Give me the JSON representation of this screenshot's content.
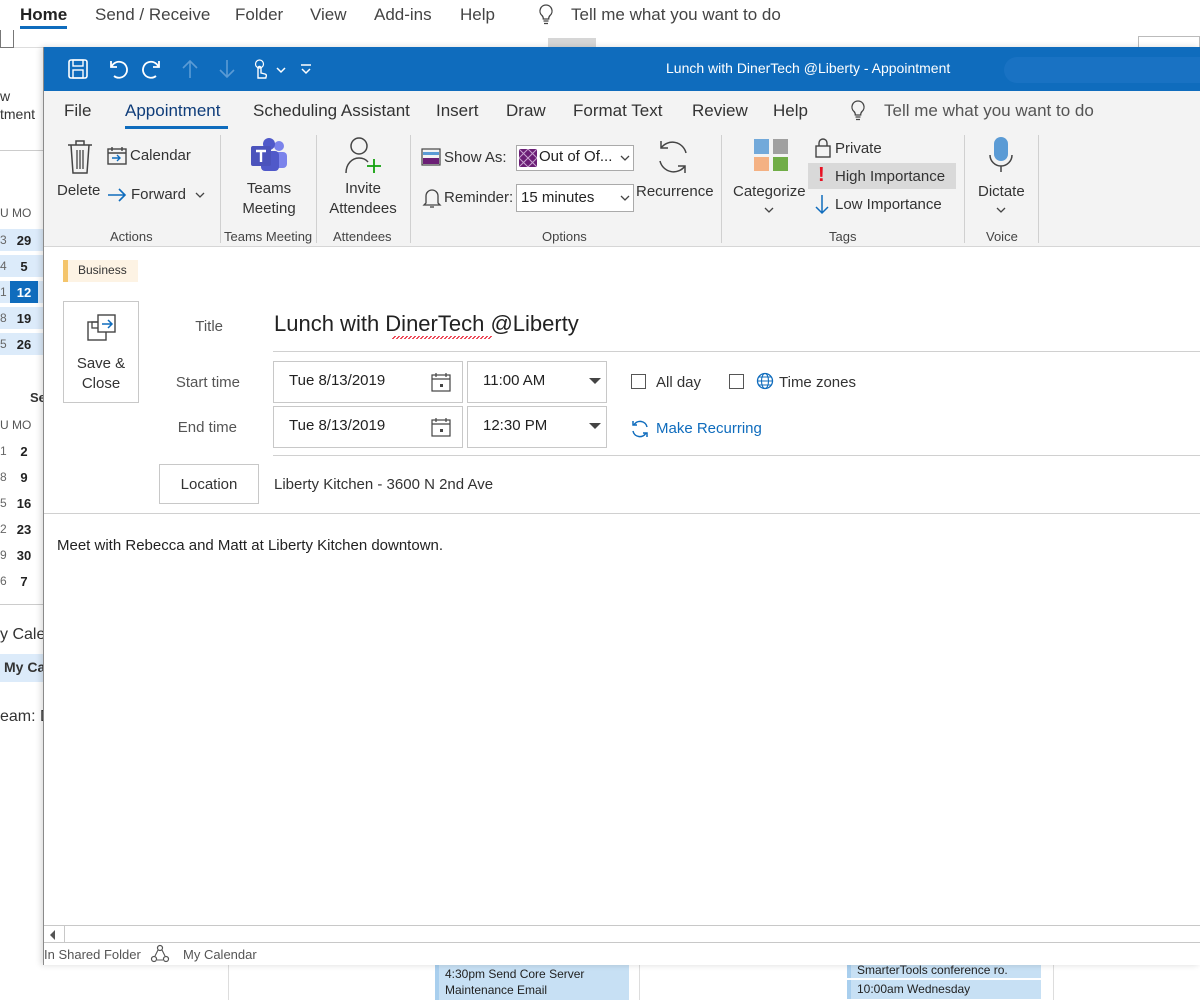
{
  "bg_menu": {
    "tabs": [
      "Home",
      "Send / Receive",
      "Folder",
      "View",
      "Add-ins",
      "Help"
    ],
    "tell_me": "Tell me what you want to do"
  },
  "bg_left": {
    "partial_w": "w",
    "partial_tment": "tment",
    "day_header_1": "MO",
    "day_header_2": "MO",
    "month_1_rows": [
      {
        "prev": "3",
        "date": "29"
      },
      {
        "prev": "4",
        "date": "5"
      },
      {
        "prev": "1",
        "date": "12"
      },
      {
        "prev": "8",
        "date": "19"
      },
      {
        "prev": "5",
        "date": "26"
      }
    ],
    "month_2_label": "Se",
    "month_2_rows": [
      {
        "prev": "1",
        "date": "2"
      },
      {
        "prev": "8",
        "date": "9"
      },
      {
        "prev": "5",
        "date": "16"
      },
      {
        "prev": "2",
        "date": "23"
      },
      {
        "prev": "9",
        "date": "30"
      },
      {
        "prev": "6",
        "date": "7"
      }
    ],
    "my_cale": "y Cale",
    "my_ca": "My Ca",
    "team": "eam: D"
  },
  "bg_events": {
    "event_left": [
      "4:30pm Send Core Server",
      "Maintenance Email"
    ],
    "event_right_1": "SmarterTools conference ro.",
    "event_right_2": "10:00am Wednesday"
  },
  "window": {
    "title": "Lunch with DinerTech @Liberty  -  Appointment",
    "tabs": [
      "File",
      "Appointment",
      "Scheduling Assistant",
      "Insert",
      "Draw",
      "Format Text",
      "Review",
      "Help"
    ],
    "tell_me": "Tell me what you want to do"
  },
  "ribbon": {
    "actions": {
      "delete": "Delete",
      "calendar": "Calendar",
      "forward": "Forward",
      "label": "Actions"
    },
    "teams": {
      "line1": "Teams",
      "line2": "Meeting",
      "label": "Teams Meeting"
    },
    "attendees": {
      "line1": "Invite",
      "line2": "Attendees",
      "label": "Attendees"
    },
    "options": {
      "show_as_label": "Show As:",
      "show_as_value": "Out of Of...",
      "reminder_label": "Reminder:",
      "reminder_value": "15 minutes",
      "recurrence": "Recurrence",
      "label": "Options"
    },
    "tags": {
      "categorize": "Categorize",
      "private": "Private",
      "high": "High Importance",
      "low": "Low Importance",
      "label": "Tags"
    },
    "voice": {
      "dictate": "Dictate",
      "label": "Voice"
    }
  },
  "form": {
    "category": "Business",
    "save_line1": "Save &",
    "save_line2": "Close",
    "title_label": "Title",
    "title_value": "Lunch with DinerTech @Liberty",
    "start_label": "Start time",
    "start_date": "Tue 8/13/2019",
    "start_time": "11:00 AM",
    "end_label": "End time",
    "end_date": "Tue 8/13/2019",
    "end_time": "12:30 PM",
    "all_day": "All day",
    "time_zones": "Time zones",
    "make_recurring": "Make Recurring",
    "location_button": "Location",
    "location_value": "Liberty Kitchen - 3600 N 2nd Ave",
    "body": "Meet with Rebecca and Matt at Liberty Kitchen downtown."
  },
  "status": {
    "shared": "In Shared Folder",
    "calendar": "My Calendar"
  },
  "colors": {
    "title_bar": "#0f6cbd",
    "accent": "#0f6cbd",
    "high_importance": "#e81123",
    "category_business": "#f4c56c"
  }
}
